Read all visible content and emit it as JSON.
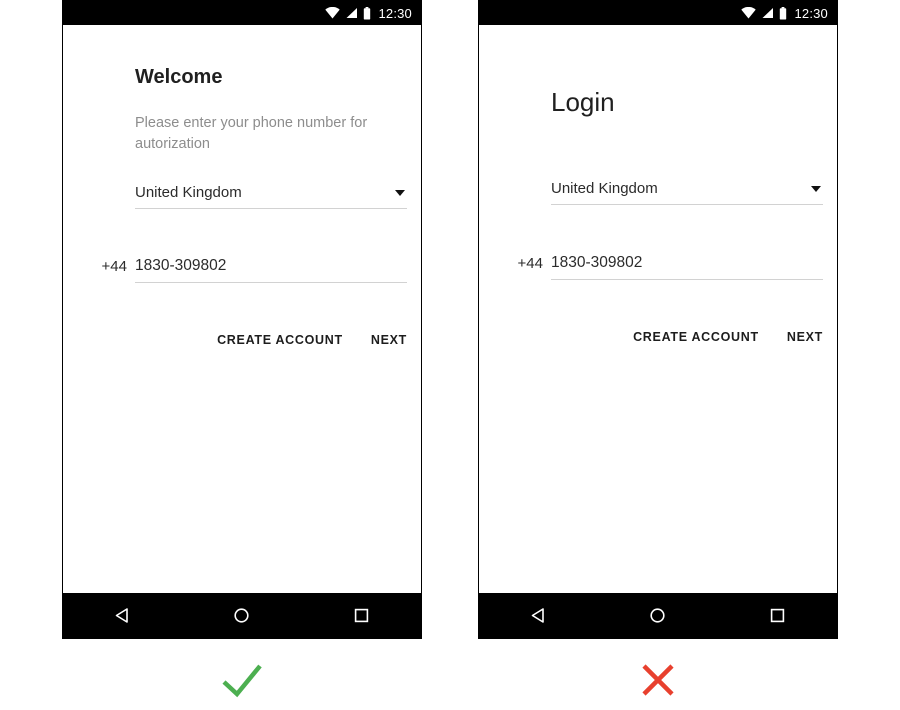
{
  "screens": [
    {
      "id": "welcome",
      "status_bar": {
        "time": "12:30",
        "icons": [
          "wifi-icon",
          "cellular-signal-icon",
          "battery-icon"
        ]
      },
      "title": "Welcome",
      "subtitle": "Please enter your phone number for autorization",
      "country_select": {
        "value": "United Kingdom",
        "icon": "chevron-down-icon"
      },
      "phone_input": {
        "dial_code": "+44",
        "value": "1830-309802"
      },
      "actions": {
        "secondary": "CREATE ACCOUNT",
        "primary": "NEXT"
      },
      "nav_bar": {
        "back": "back-triangle-icon",
        "home": "home-circle-icon",
        "recents": "recents-square-icon"
      },
      "verdict": {
        "type": "check",
        "color": "#4caf50"
      }
    },
    {
      "id": "login",
      "status_bar": {
        "time": "12:30",
        "icons": [
          "wifi-icon",
          "cellular-signal-icon",
          "battery-icon"
        ]
      },
      "title": "Login",
      "subtitle": "",
      "country_select": {
        "value": "United Kingdom",
        "icon": "chevron-down-icon"
      },
      "phone_input": {
        "dial_code": "+44",
        "value": "1830-309802"
      },
      "actions": {
        "secondary": "CREATE ACCOUNT",
        "primary": "NEXT"
      },
      "nav_bar": {
        "back": "back-triangle-icon",
        "home": "home-circle-icon",
        "recents": "recents-square-icon"
      },
      "verdict": {
        "type": "cross",
        "color": "#e8402e"
      }
    }
  ],
  "colors": {
    "status_bar_bg": "#000000",
    "nav_bar_bg": "#000000",
    "screen_bg": "#ffffff",
    "text_primary": "#202020",
    "text_secondary": "#8d8d8d",
    "underline": "#d2d2d2",
    "pass": "#4caf50",
    "fail": "#e8402e"
  }
}
